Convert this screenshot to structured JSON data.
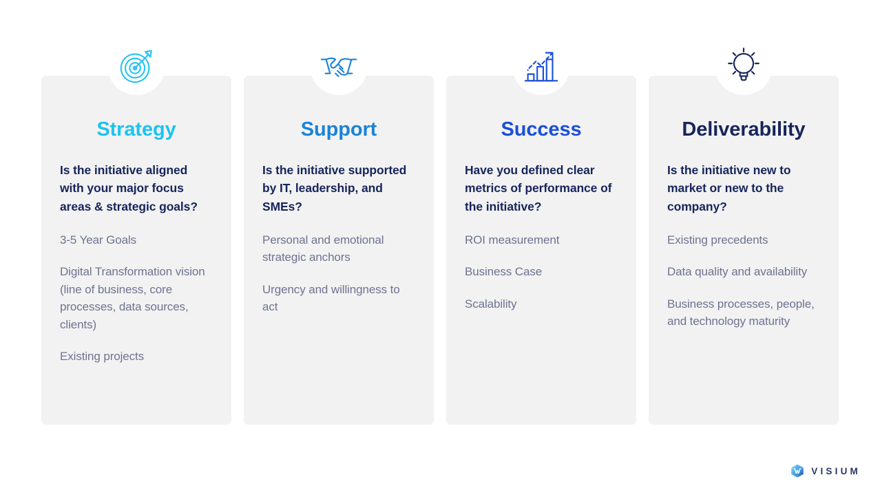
{
  "slide": {
    "background_color": "#ffffff",
    "card_background_color": "#f2f2f2",
    "question_color": "#17255b",
    "body_color": "#6d7390"
  },
  "columns": [
    {
      "icon": "target-icon",
      "icon_color": "#25c4f2",
      "title": "Strategy",
      "title_color": "#1cc3f0",
      "question": "Is the initiative aligned with your major focus areas & strategic goals?",
      "points": [
        "3-5 Year Goals",
        "Digital Transformation vision (line of business, core processes, data sources, clients)",
        "Existing projects"
      ]
    },
    {
      "icon": "handshake-icon",
      "icon_color": "#1a83d8",
      "title": "Support",
      "title_color": "#1a83d8",
      "question": "Is the initiative supported by IT, leadership, and SMEs?",
      "points": [
        "Personal and emotional strategic anchors",
        "Urgency and willingness to act"
      ]
    },
    {
      "icon": "growth-chart-icon",
      "icon_color": "#1b4fd8",
      "title": "Success",
      "title_color": "#1b4fd8",
      "question": "Have you defined clear metrics of performance of the initiative?",
      "points": [
        "ROI measurement",
        "Business Case",
        "Scalability"
      ]
    },
    {
      "icon": "lightbulb-icon",
      "icon_color": "#17255b",
      "title": "Deliverability",
      "title_color": "#17255b",
      "question": "Is the initiative new to market or new to the company?",
      "points": [
        "Existing precedents",
        "Data quality and availability",
        "Business processes, people, and technology maturity"
      ]
    }
  ],
  "logo": {
    "icon": "visium-logo-icon",
    "wordmark": "VISIUM",
    "wordmark_color": "#2b3566"
  }
}
